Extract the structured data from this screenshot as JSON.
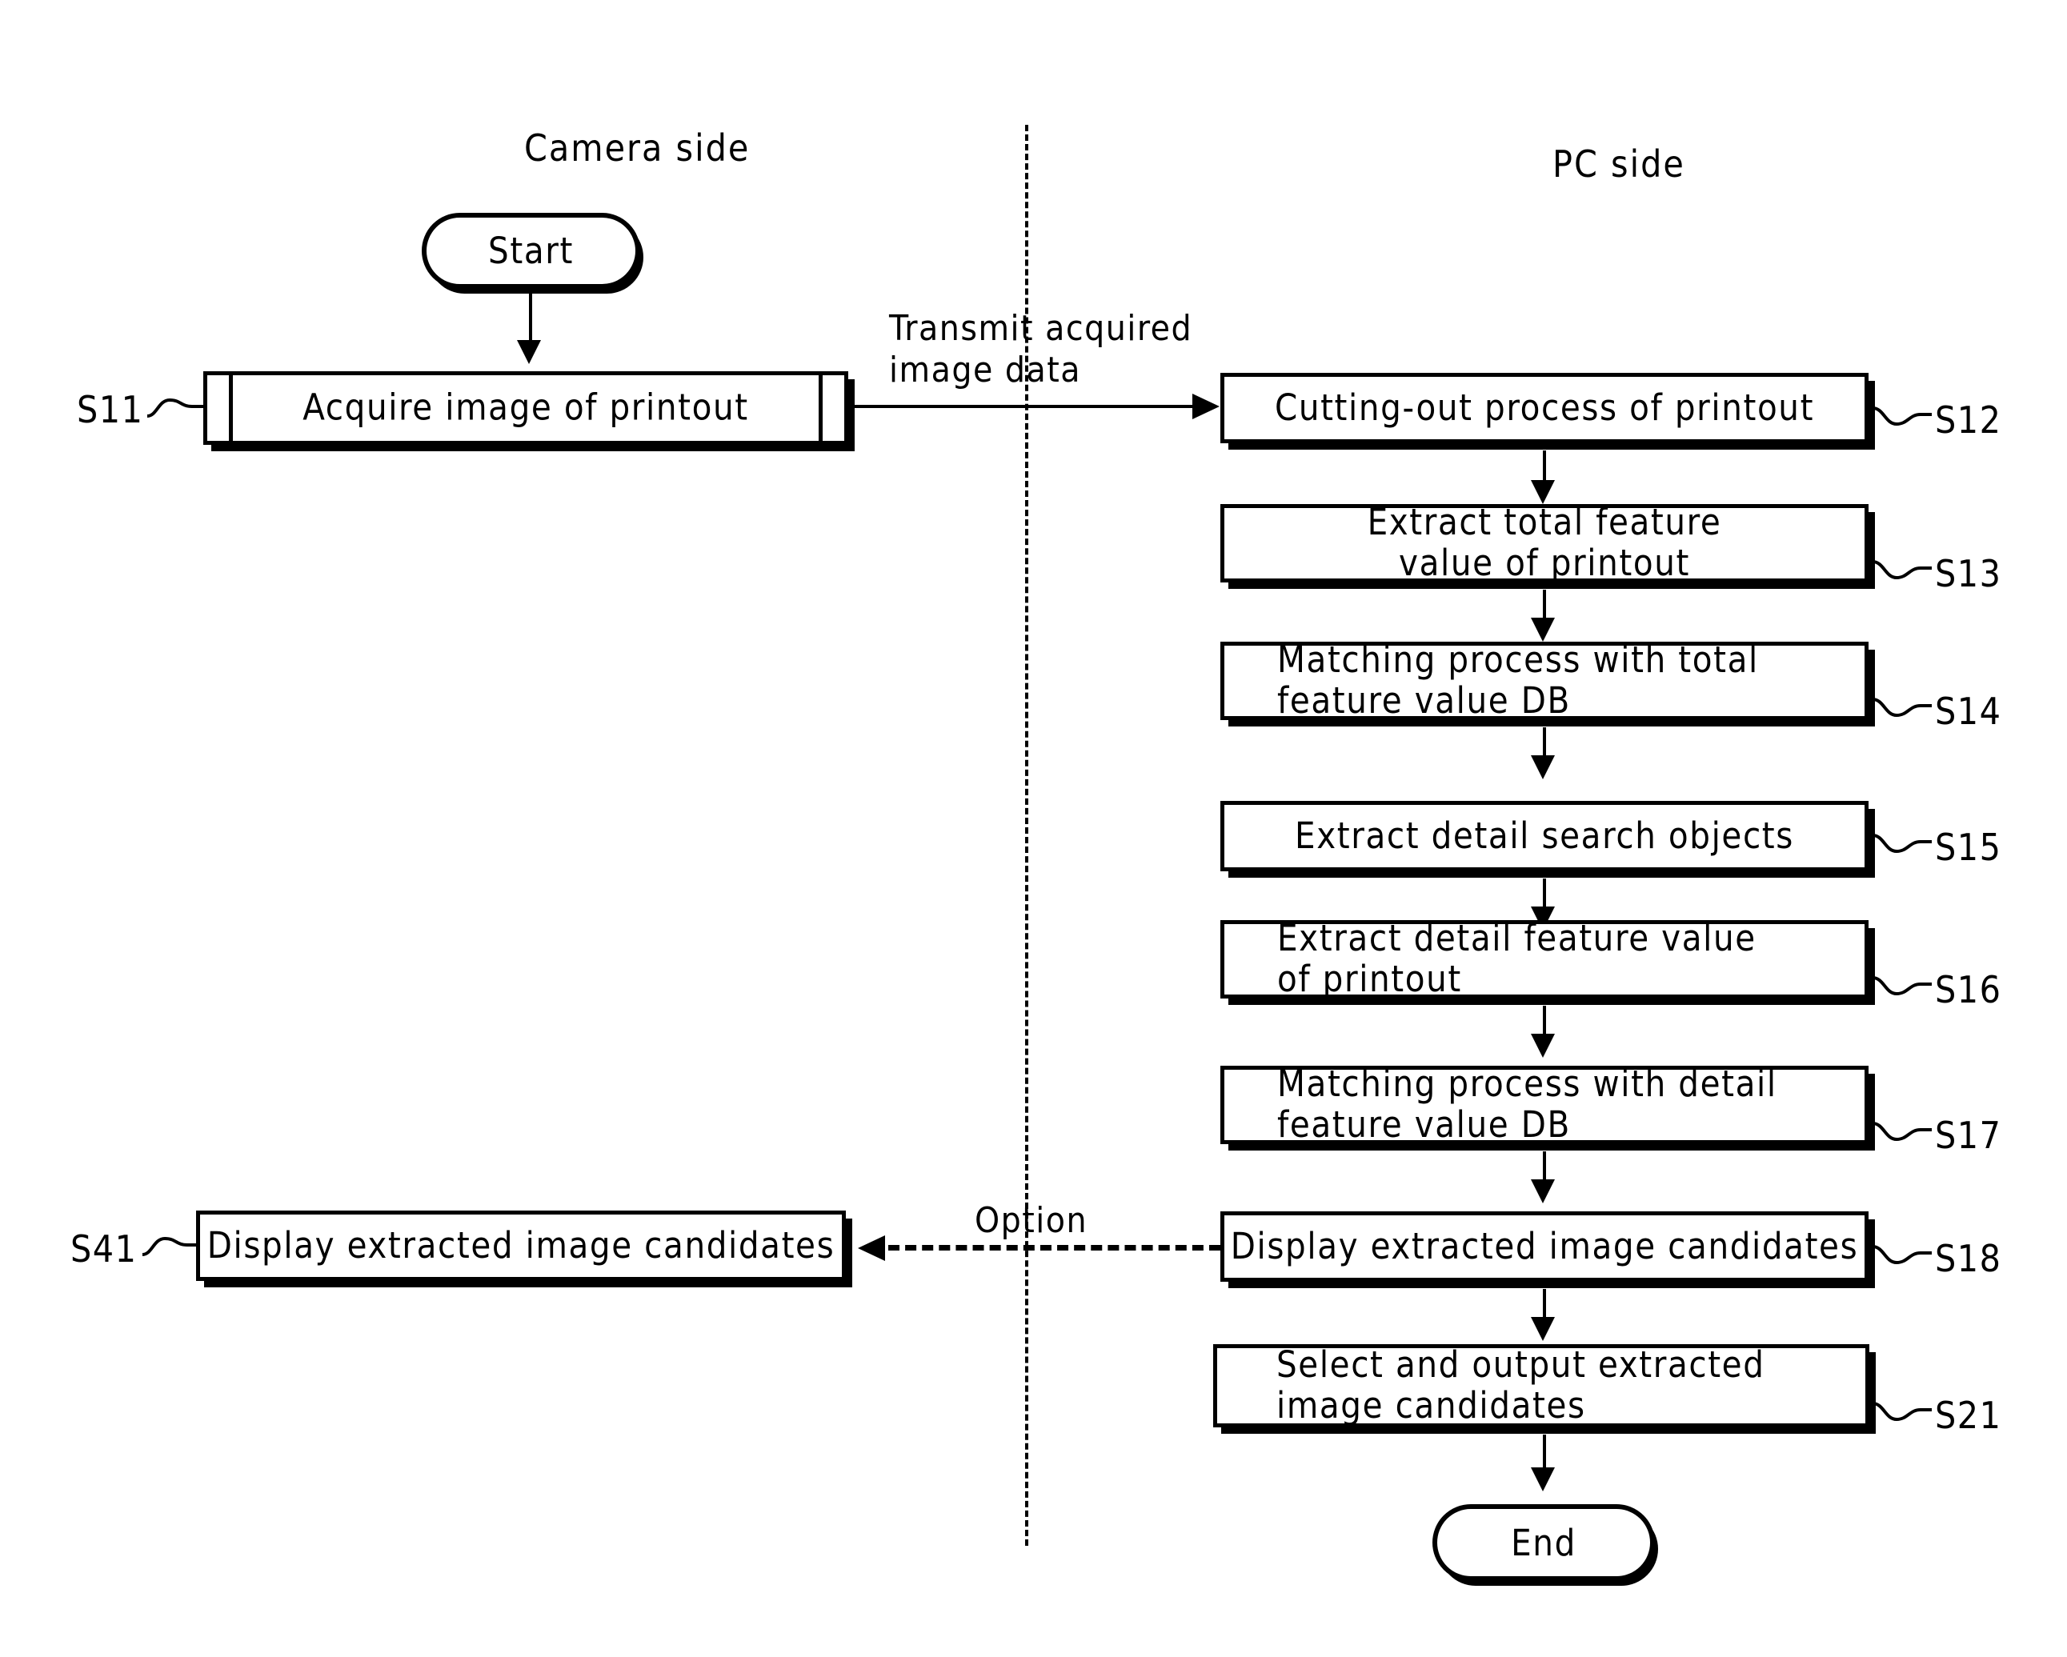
{
  "figure": {
    "type": "flowchart",
    "lanes": [
      {
        "id": "camera",
        "title": "Camera side"
      },
      {
        "id": "pc",
        "title": "PC side"
      }
    ],
    "edge_labels": {
      "transmit_line1": "Transmit acquired",
      "transmit_line2": "image data",
      "option": "Option"
    },
    "nodes": {
      "start": {
        "label": "Start",
        "shape": "terminator"
      },
      "end": {
        "label": "End",
        "shape": "terminator"
      },
      "s11": {
        "ref": "S11",
        "label": "Acquire image of printout",
        "shape": "subroutine"
      },
      "s12": {
        "ref": "S12",
        "label": "Cutting-out process of printout",
        "shape": "process"
      },
      "s13": {
        "ref": "S13",
        "line1": "Extract total feature",
        "line2": "value of printout",
        "shape": "process"
      },
      "s14": {
        "ref": "S14",
        "line1": "Matching process with total",
        "line2": "feature value DB",
        "shape": "process"
      },
      "s15": {
        "ref": "S15",
        "label": "Extract detail search objects",
        "shape": "process"
      },
      "s16": {
        "ref": "S16",
        "line1": "Extract detail feature value",
        "line2": "of printout",
        "shape": "process"
      },
      "s17": {
        "ref": "S17",
        "line1": "Matching process with detail",
        "line2": "feature value DB",
        "shape": "process"
      },
      "s18": {
        "ref": "S18",
        "label": "Display extracted image candidates",
        "shape": "process"
      },
      "s21": {
        "ref": "S21",
        "line1": "Select and output extracted",
        "line2": "image candidates",
        "shape": "process"
      },
      "s41": {
        "ref": "S41",
        "label": "Display extracted image candidates",
        "shape": "process"
      }
    },
    "colors": {
      "ink": "#000000",
      "paper": "#ffffff"
    }
  }
}
